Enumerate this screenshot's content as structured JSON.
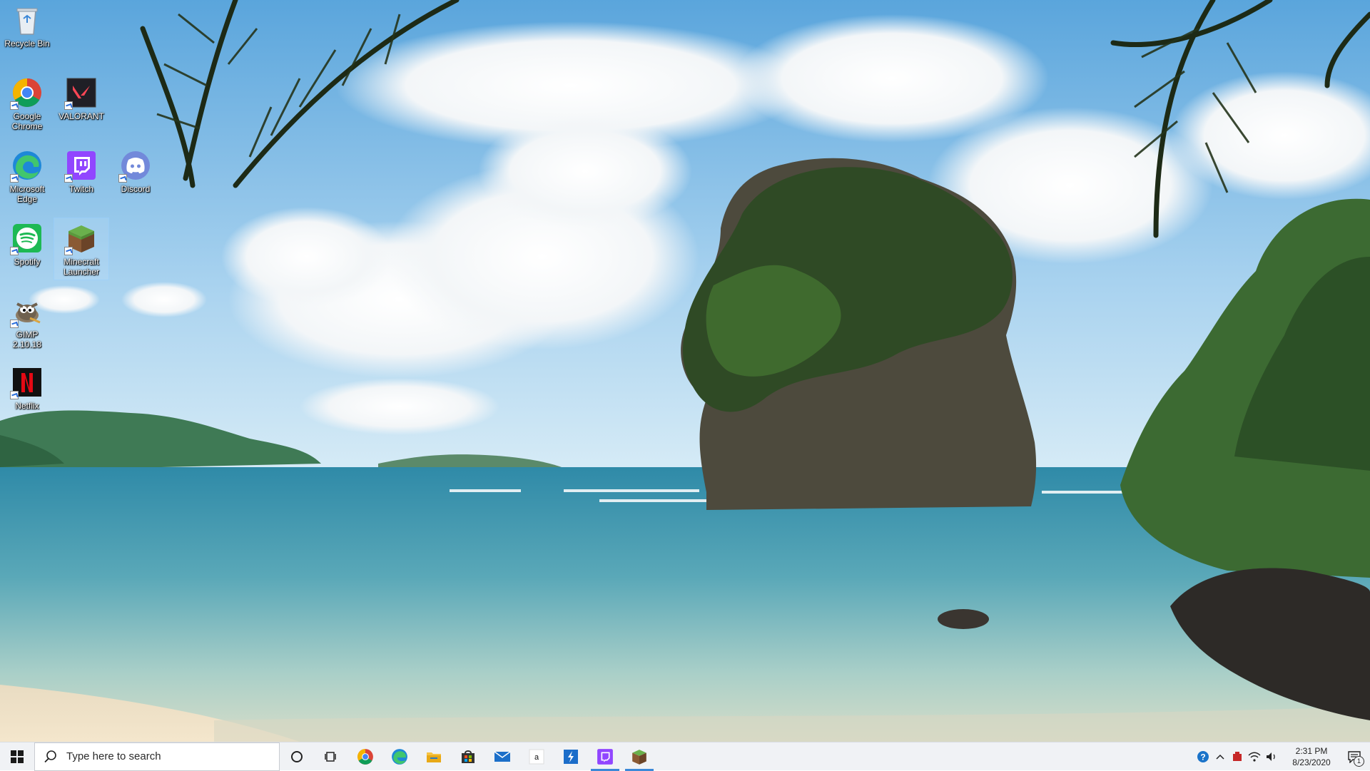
{
  "desktop": {
    "icons": [
      {
        "label": "Recycle Bin",
        "icon": "recycle-bin-icon"
      },
      {
        "label": "Google Chrome",
        "icon": "chrome-icon"
      },
      {
        "label": "VALORANT",
        "icon": "valorant-icon"
      },
      {
        "label": "Microsoft Edge",
        "icon": "edge-icon"
      },
      {
        "label": "Twitch",
        "icon": "twitch-icon"
      },
      {
        "label": "Discord",
        "icon": "discord-icon"
      },
      {
        "label": "Spotify",
        "icon": "spotify-icon"
      },
      {
        "label": "Minecraft Launcher",
        "icon": "minecraft-icon",
        "selected": true
      },
      {
        "label": "GIMP 2.10.18",
        "icon": "gimp-icon"
      },
      {
        "label": "Netflix",
        "icon": "netflix-icon"
      }
    ]
  },
  "taskbar": {
    "search_placeholder": "Type here to search",
    "pinned": [
      {
        "name": "cortana-icon"
      },
      {
        "name": "task-view-icon"
      },
      {
        "name": "chrome-icon"
      },
      {
        "name": "edge-icon"
      },
      {
        "name": "file-explorer-icon"
      },
      {
        "name": "microsoft-store-icon"
      },
      {
        "name": "mail-icon"
      },
      {
        "name": "amazon-icon"
      },
      {
        "name": "app-blue-icon"
      },
      {
        "name": "twitch-icon",
        "active": true
      },
      {
        "name": "minecraft-icon",
        "active": true
      }
    ],
    "tray": {
      "time": "2:31 PM",
      "date": "8/23/2020",
      "notification_count": "1"
    }
  },
  "colors": {
    "taskbar_bg": "#f0f2f5",
    "active_indicator": "#3b88d8",
    "sky": "#6fb4e3",
    "sea": "#4b9aae"
  }
}
